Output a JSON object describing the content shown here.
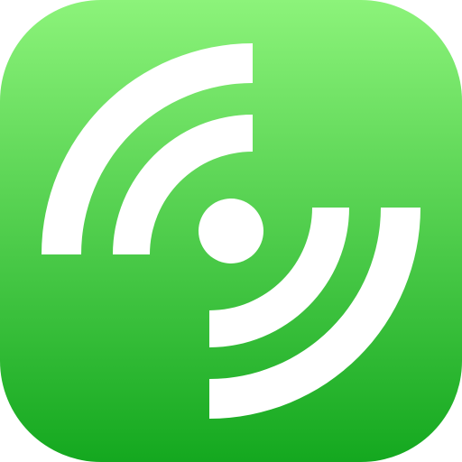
{
  "app_icon": {
    "icon": "radio-signal-broadcast-icon",
    "colors": {
      "gradient_top": "#8cf37a",
      "gradient_bottom": "#14a81f",
      "glyph": "#ffffff"
    }
  }
}
